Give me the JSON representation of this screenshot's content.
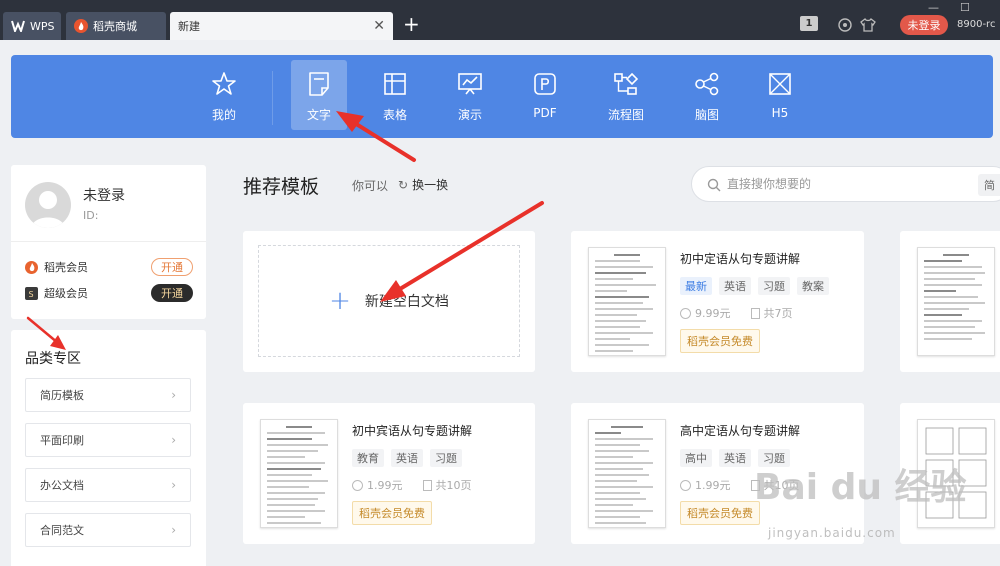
{
  "tabs": [
    {
      "label": "WPS"
    },
    {
      "label": "稻壳商城"
    },
    {
      "label": "新建"
    }
  ],
  "titlebar": {
    "window_count": "1",
    "login_label": "未登录",
    "version_text": "8900-rc"
  },
  "toolbar": {
    "items": [
      {
        "label": "我的",
        "icon": "star-icon"
      },
      {
        "label": "文字",
        "icon": "document-icon"
      },
      {
        "label": "表格",
        "icon": "spreadsheet-icon"
      },
      {
        "label": "演示",
        "icon": "presentation-icon"
      },
      {
        "label": "PDF",
        "icon": "pdf-icon"
      },
      {
        "label": "流程图",
        "icon": "flowchart-icon"
      },
      {
        "label": "脑图",
        "icon": "mindmap-icon"
      },
      {
        "label": "H5",
        "icon": "h5-icon"
      }
    ],
    "active_index": 1
  },
  "user": {
    "name": "未登录",
    "id_label": "ID:",
    "memberships": [
      {
        "label": "稻壳会员",
        "action": "开通"
      },
      {
        "label": "超级会员",
        "action": "开通"
      }
    ]
  },
  "categories": {
    "title": "品类专区",
    "items": [
      "简历模板",
      "平面印刷",
      "办公文档",
      "合同范文"
    ]
  },
  "main": {
    "title": "推荐模板",
    "hint": "你可以",
    "refresh_label": "换一换",
    "search_placeholder": "直接搜你想要的",
    "search_button": "简",
    "blank_label": "新建空白文档"
  },
  "templates": [
    {
      "name": "初中定语从句专题讲解",
      "tags": [
        "最新",
        "英语",
        "习题",
        "教案"
      ],
      "price": "9.99元",
      "pages": "共7页",
      "badge": "稻壳会员免费"
    },
    {
      "name": "初中宾语从句专题讲解",
      "tags": [
        "教育",
        "英语",
        "习题"
      ],
      "price": "1.99元",
      "pages": "共10页",
      "badge": "稻壳会员免费"
    },
    {
      "name": "高中定语从句专题讲解",
      "tags": [
        "高中",
        "英语",
        "习题"
      ],
      "price": "1.99元",
      "pages": "共10页",
      "badge": "稻壳会员免费"
    }
  ],
  "watermark": {
    "text": "Bai du 经验",
    "sub": "jingyan.baidu.com"
  },
  "colors": {
    "accent": "#4f86e4",
    "tabbar": "#2d323c",
    "login_pill": "#e2584a",
    "arrow": "#e8312a"
  }
}
